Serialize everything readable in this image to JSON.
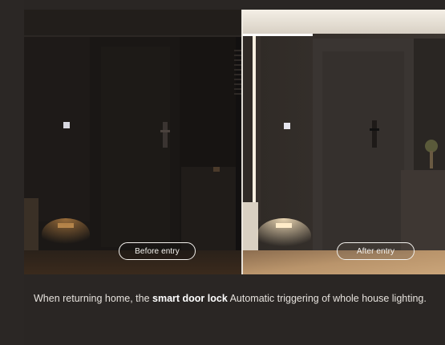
{
  "labels": {
    "before": "Before entry",
    "after": "After entry"
  },
  "caption": {
    "lead": "When returning home, the ",
    "highlight": "smart door lock",
    "tail": " Automatic triggering of whole house lighting."
  },
  "colors": {
    "background": "#2a2624",
    "caption_text": "#e6e2dd",
    "highlight_text": "#ffffff",
    "pill_border": "#f2f0ec"
  },
  "icons": {
    "door_handle": "smart-lock-icon",
    "wall_switch": "light-switch-icon"
  }
}
